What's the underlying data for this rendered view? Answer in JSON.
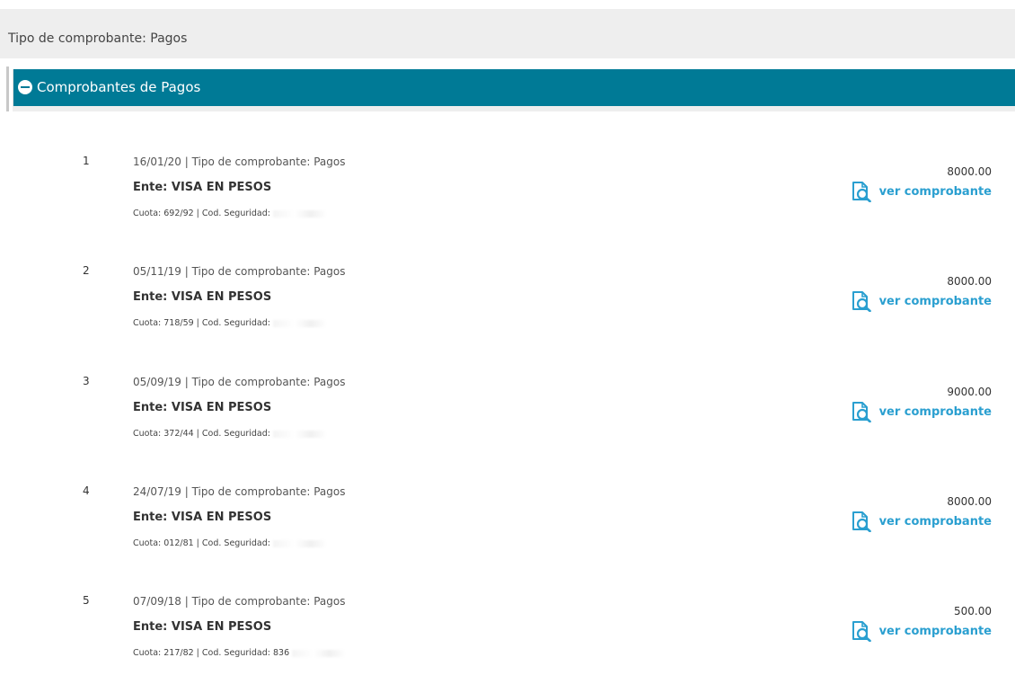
{
  "filter": {
    "label": "Tipo de comprobante: Pagos"
  },
  "section": {
    "title": "Comprobantes de Pagos",
    "toggle_icon": "collapse-minus-icon"
  },
  "colors": {
    "header": "#007a96",
    "link": "#2a9fd0"
  },
  "receipts": [
    {
      "num": "1",
      "meta": "16/01/20  |  Tipo de comprobante: Pagos",
      "ente": "Ente: VISA EN PESOS",
      "cuota": "Cuota: 692/92  |  Cod. Seguridad:",
      "amount": "8000.00",
      "link": "ver comprobante",
      "icon": "document-search-icon"
    },
    {
      "num": "2",
      "meta": "05/11/19  |  Tipo de comprobante: Pagos",
      "ente": "Ente: VISA EN PESOS",
      "cuota": "Cuota: 718/59  |  Cod. Seguridad:",
      "amount": "8000.00",
      "link": "ver comprobante",
      "icon": "document-search-icon"
    },
    {
      "num": "3",
      "meta": "05/09/19  |  Tipo de comprobante: Pagos",
      "ente": "Ente: VISA EN PESOS",
      "cuota": "Cuota: 372/44  |  Cod. Seguridad:",
      "amount": "9000.00",
      "link": "ver comprobante",
      "icon": "document-search-icon"
    },
    {
      "num": "4",
      "meta": "24/07/19  |  Tipo de comprobante: Pagos",
      "ente": "Ente: VISA EN PESOS",
      "cuota": "Cuota: 012/81  |  Cod. Seguridad:",
      "amount": "8000.00",
      "link": "ver comprobante",
      "icon": "document-search-icon"
    },
    {
      "num": "5",
      "meta": "07/09/18  |  Tipo de comprobante: Pagos",
      "ente": "Ente: VISA EN PESOS",
      "cuota": "Cuota: 217/82  |  Cod. Seguridad: 836",
      "amount": "500.00",
      "link": "ver comprobante",
      "icon": "document-search-icon"
    }
  ]
}
